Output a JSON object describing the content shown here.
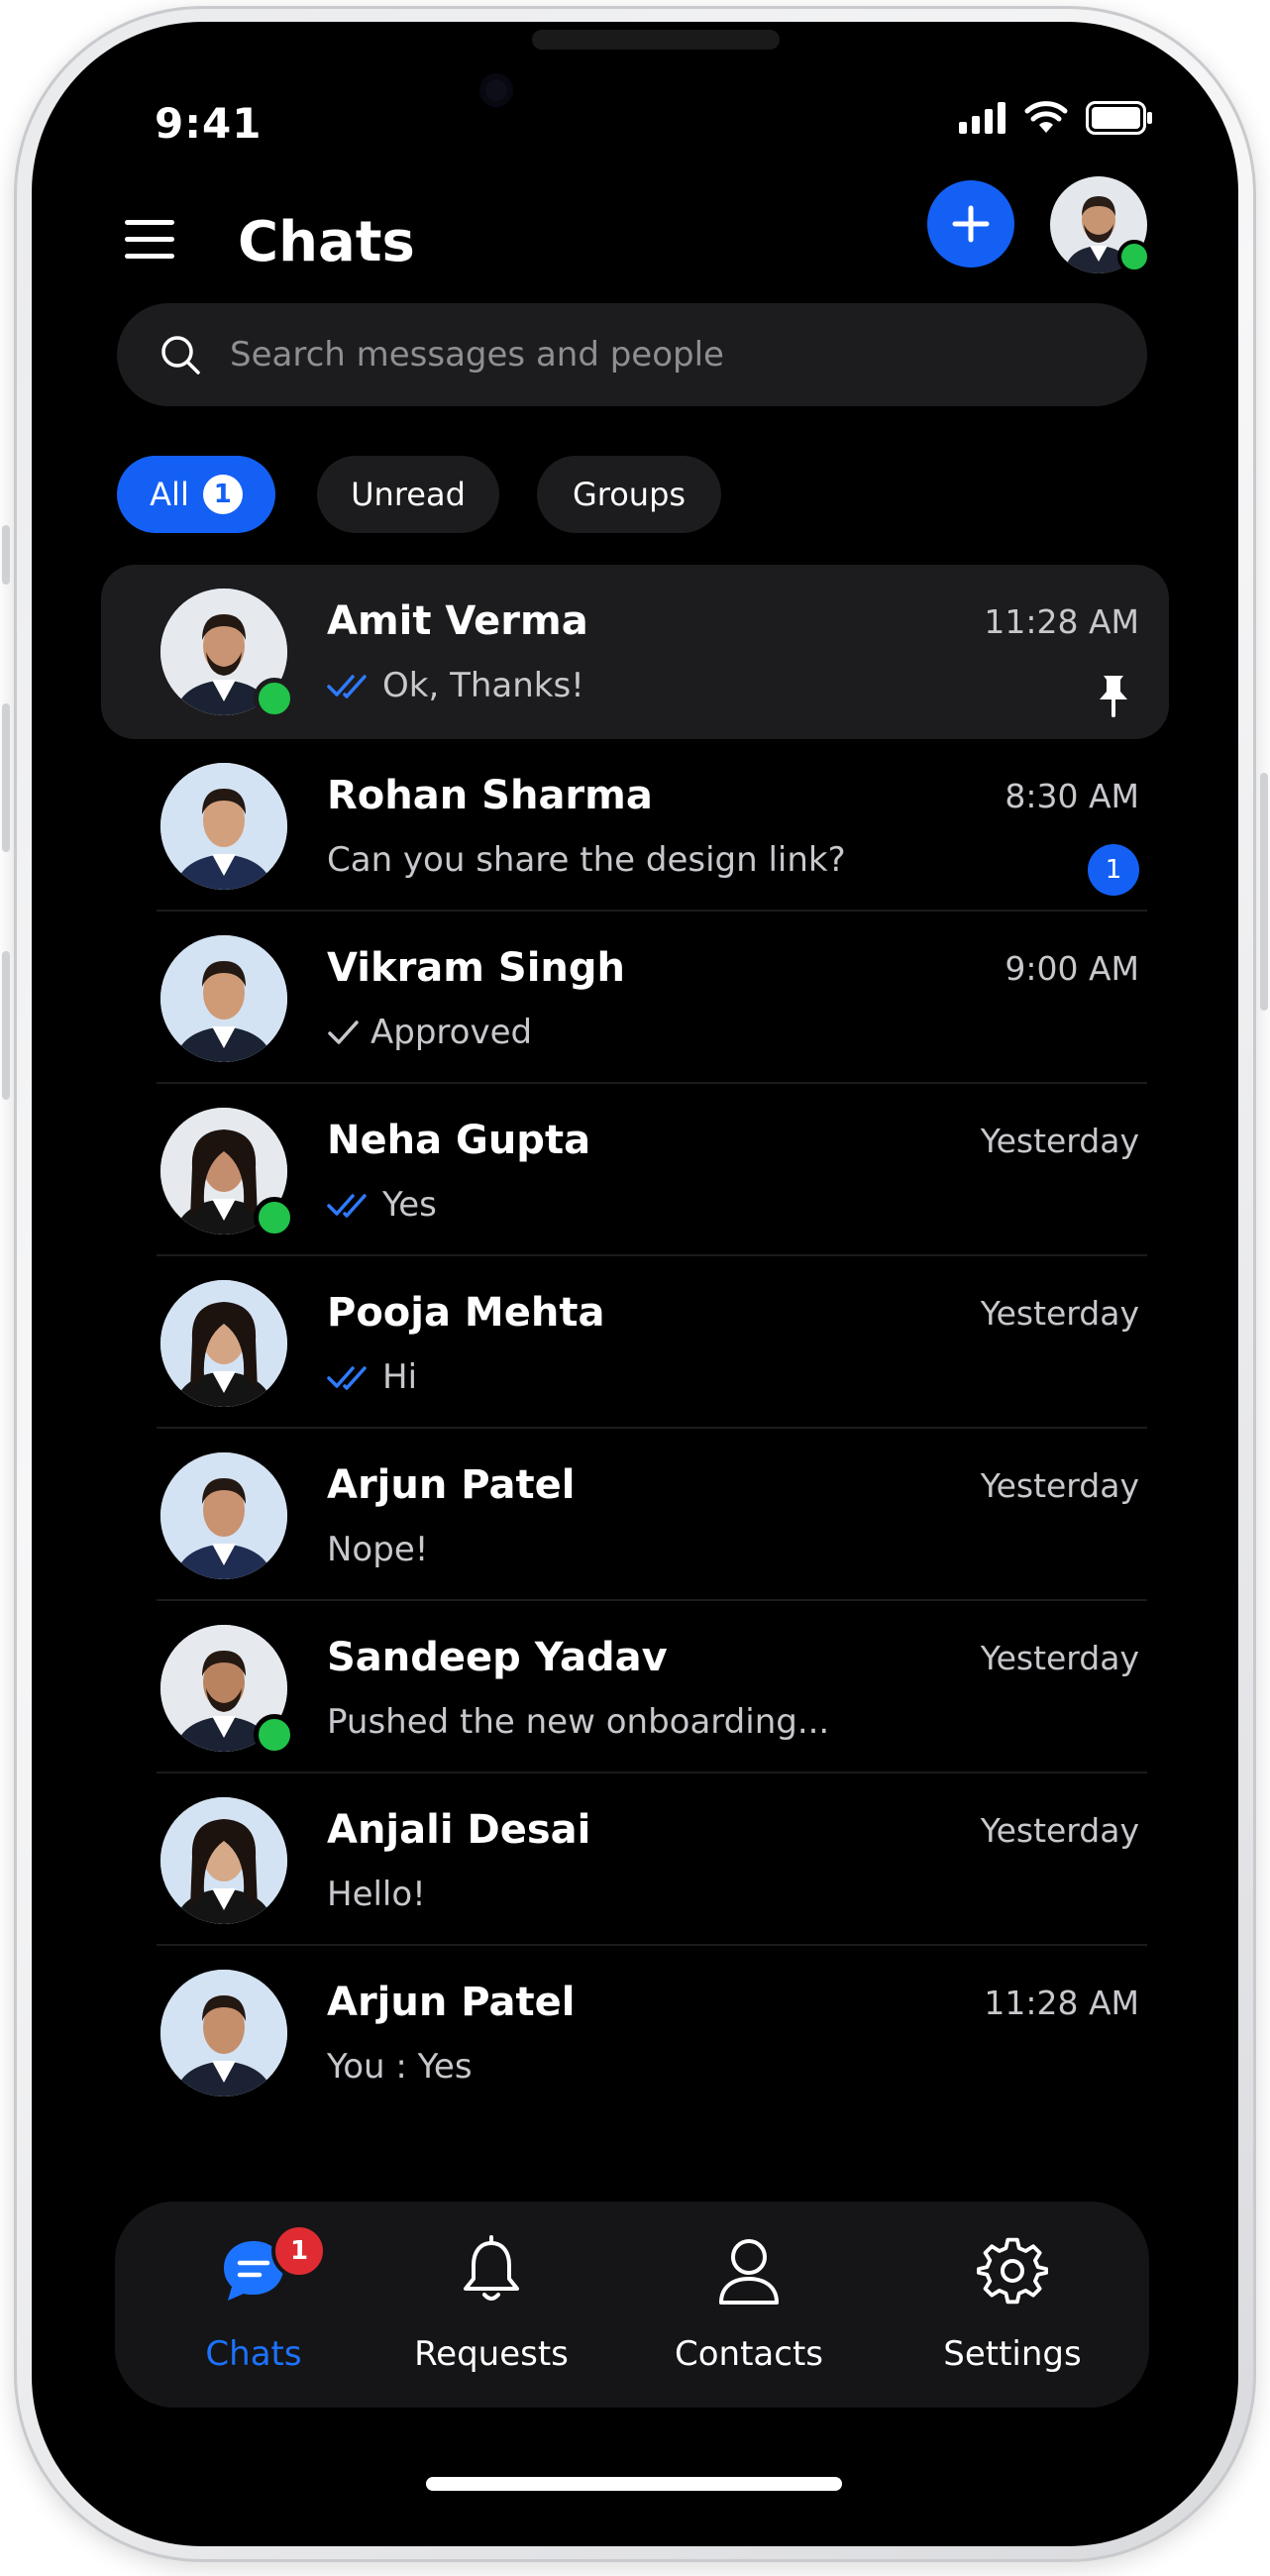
{
  "status_bar": {
    "time": "9:41"
  },
  "header": {
    "title": "Chats"
  },
  "search": {
    "placeholder": "Search messages and people"
  },
  "filters": [
    {
      "label": "All",
      "count": "1",
      "active": true
    },
    {
      "label": "Unread"
    },
    {
      "label": "Groups"
    }
  ],
  "chats": [
    {
      "name": "Amit Verma",
      "time": "11:28 AM",
      "message": "Ok, Thanks!",
      "receipt": "double-check",
      "online": true,
      "pinned": true
    },
    {
      "name": "Rohan Sharma",
      "time": "8:30 AM",
      "message": "Can you share the design link?",
      "unread": "1"
    },
    {
      "name": "Vikram Singh",
      "time": "9:00 AM",
      "message": "Approved",
      "receipt": "single-check"
    },
    {
      "name": "Neha Gupta",
      "time": "Yesterday",
      "message": "Yes",
      "receipt": "double-check",
      "online": true
    },
    {
      "name": "Pooja Mehta",
      "time": "Yesterday",
      "message": "Hi",
      "receipt": "double-check"
    },
    {
      "name": "Arjun Patel",
      "time": "Yesterday",
      "message": "Nope!"
    },
    {
      "name": "Sandeep Yadav",
      "time": "Yesterday",
      "message": "Pushed the new onboarding...",
      "online": true
    },
    {
      "name": "Anjali Desai",
      "time": "Yesterday",
      "message": "Hello!"
    },
    {
      "name": "Arjun Patel",
      "time": "11:28 AM",
      "message": "You : Yes"
    }
  ],
  "bottom_nav": [
    {
      "label": "Chats",
      "icon": "chat-bubble-icon",
      "badge": "1",
      "active": true
    },
    {
      "label": "Requests",
      "icon": "bell-icon"
    },
    {
      "label": "Contacts",
      "icon": "person-icon"
    },
    {
      "label": "Settings",
      "icon": "gear-icon"
    }
  ],
  "colors": {
    "accent": "#1460f5",
    "online": "#21c34a",
    "badge_red": "#e02b33",
    "background": "#000000"
  }
}
